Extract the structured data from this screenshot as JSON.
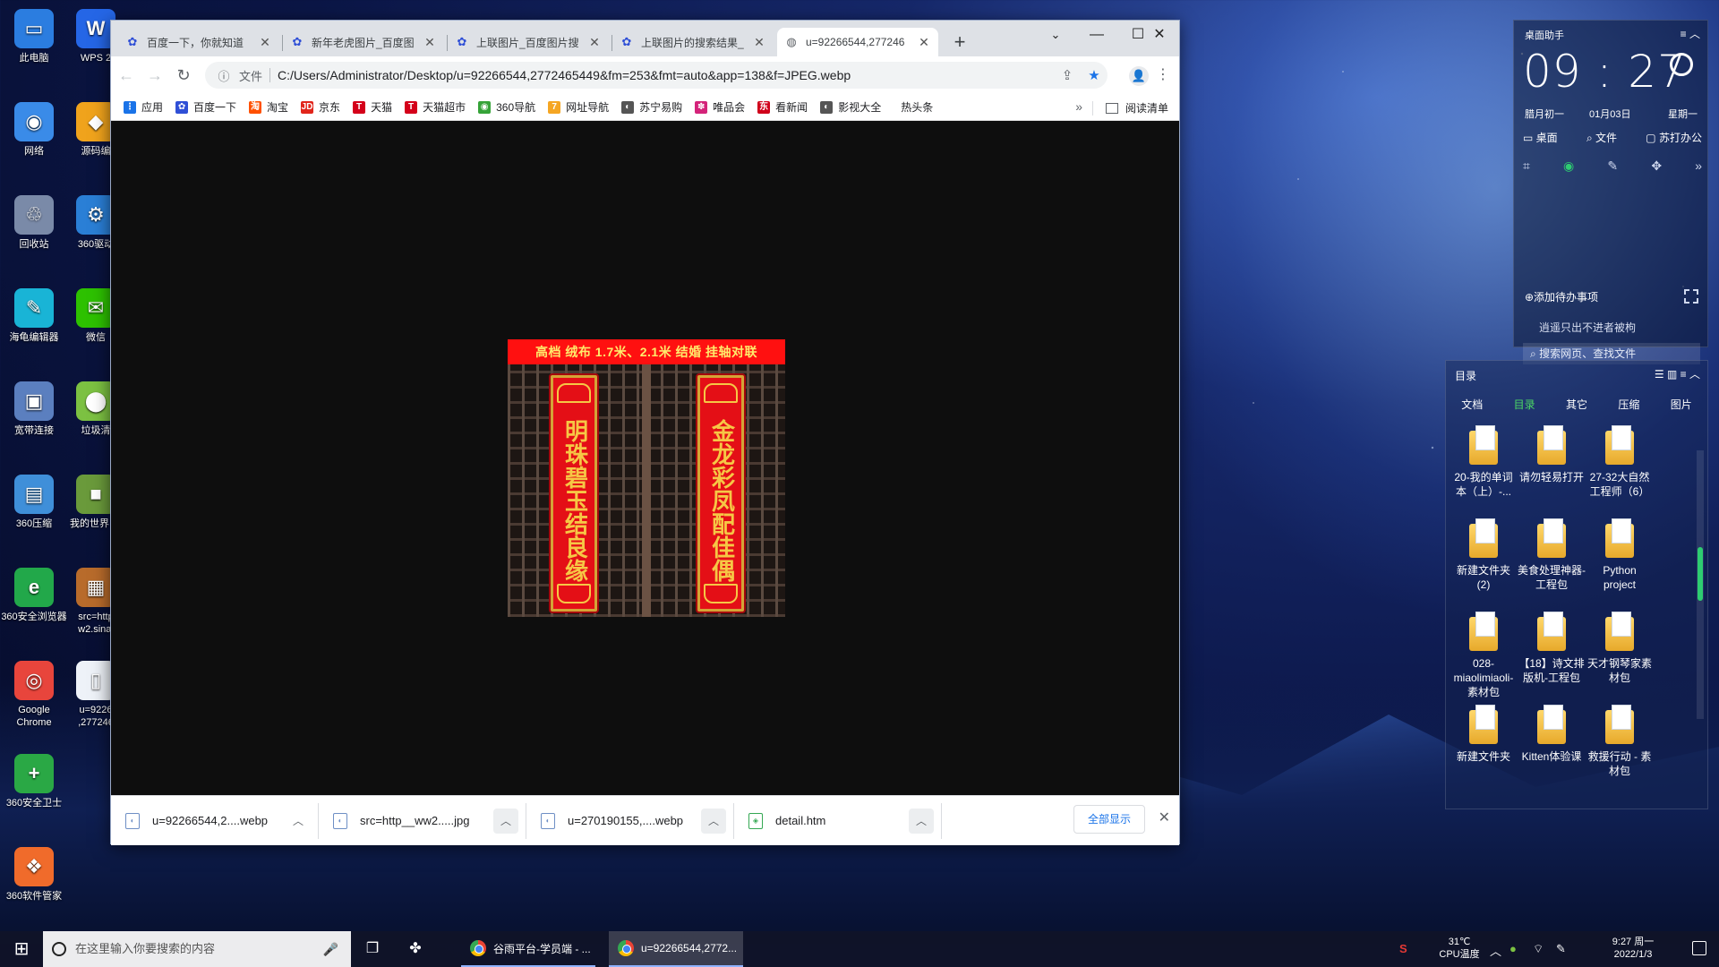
{
  "desktop_left": [
    {
      "label": "此电脑",
      "color": "#2b7de0",
      "glyph": "▭"
    },
    {
      "label": "网络",
      "color": "#3a8be8",
      "glyph": "◉"
    },
    {
      "label": "回收站",
      "color": "#7a8aa8",
      "glyph": "♲"
    },
    {
      "label": "海龟编辑器",
      "color": "#19b4d6",
      "glyph": "✎"
    },
    {
      "label": "宽带连接",
      "color": "#5b7fbf",
      "glyph": "▣"
    },
    {
      "label": "360压缩",
      "color": "#3f8fd9",
      "glyph": "▤"
    },
    {
      "label": "360安全浏览器",
      "color": "#22a84a",
      "glyph": "e"
    },
    {
      "label": "Google Chrome",
      "color": "#e8453c",
      "glyph": "◎"
    },
    {
      "label": "360安全卫士",
      "color": "#2aa845",
      "glyph": "+"
    },
    {
      "label": "360软件管家",
      "color": "#f06b2b",
      "glyph": "❖"
    }
  ],
  "desktop_right": [
    {
      "label": "WPS 2",
      "color": "#2566e6",
      "glyph": "W"
    },
    {
      "label": "源码编",
      "color": "#f0a31c",
      "glyph": "◆"
    },
    {
      "label": "360驱动",
      "color": "#2a7fd6",
      "glyph": "⚙"
    },
    {
      "label": "微信",
      "color": "#2dc100",
      "glyph": "✉"
    },
    {
      "label": "垃圾清",
      "color": "#7cc142",
      "glyph": "⬤"
    },
    {
      "label": "我的世界 器",
      "color": "#6a9a3b",
      "glyph": "■"
    },
    {
      "label": "src=http w2.sinai",
      "color": "#b86b2b",
      "glyph": "▦"
    },
    {
      "label": "u=9226 ,277246",
      "color": "#eef2f8",
      "glyph": "▯"
    }
  ],
  "browser": {
    "tabs": [
      {
        "title": "百度一下，你就知道"
      },
      {
        "title": "新年老虎图片_百度图"
      },
      {
        "title": "上联图片_百度图片搜"
      },
      {
        "title": "上联图片的搜索结果_"
      },
      {
        "title": "u=92266544,277246"
      }
    ],
    "new_tab": "+",
    "omnibox": {
      "label": "文件",
      "url": "C:/Users/Administrator/Desktop/u=92266544,2772465449&fm=253&fmt=auto&app=138&f=JPEG.webp"
    },
    "bookmarks": [
      {
        "label": "应用",
        "color": "#1a73e8",
        "glyph": "⋮"
      },
      {
        "label": "百度一下",
        "color": "#2f4fd6",
        "glyph": "✿"
      },
      {
        "label": "淘宝",
        "color": "#ff5000",
        "glyph": "淘"
      },
      {
        "label": "京东",
        "color": "#e1251b",
        "glyph": "JD"
      },
      {
        "label": "天猫",
        "color": "#d4001a",
        "glyph": "T"
      },
      {
        "label": "天猫超市",
        "color": "#d4001a",
        "glyph": "T"
      },
      {
        "label": "360导航",
        "color": "#35a338",
        "glyph": "◉"
      },
      {
        "label": "网址导航",
        "color": "#f5a623",
        "glyph": "7"
      },
      {
        "label": "苏宁易购",
        "color": "#555555",
        "glyph": "◐"
      },
      {
        "label": "唯品会",
        "color": "#d4237a",
        "glyph": "✽"
      },
      {
        "label": "看新闻",
        "color": "#d0021b",
        "glyph": "东"
      },
      {
        "label": "影视大全",
        "color": "#555555",
        "glyph": "◐"
      },
      {
        "label": "热头条",
        "color": "#ffffff",
        "glyph": ""
      }
    ],
    "more": "»",
    "reading_list": "阅读清单",
    "product": {
      "banner": "高档 绒布 1.7米、2.1米 结婚 挂轴对联",
      "left_scroll": "明珠碧玉结良缘",
      "right_scroll": "金龙彩凤配佳偶"
    },
    "downloads": [
      {
        "name": "u=92266544,2....webp"
      },
      {
        "name": "src=http__ww2.....jpg"
      },
      {
        "name": "u=270190155,....webp"
      },
      {
        "name": "detail.htm"
      }
    ],
    "show_all": "全部显示"
  },
  "clock_widget": {
    "title": "桌面助手",
    "time": "09 : 27",
    "lunar": "腊月初一",
    "date": "01月03日",
    "weekday": "星期一",
    "actions": [
      "桌面",
      "文件",
      "苏打办公"
    ],
    "add_todo": "⊕添加待办事项",
    "tip": "逍遥只出不进者被枸",
    "search": "搜索网页、查找文件"
  },
  "dir_widget": {
    "title": "目录",
    "tabs": [
      "文档",
      "目录",
      "其它",
      "压缩",
      "图片"
    ],
    "active_tab": "目录",
    "items": [
      "20-我的单词本（上）-...",
      "请勿轻易打开",
      "27-32大自然工程师（6）",
      "新建文件夹 (2)",
      "美食处理神器-工程包",
      "Python project",
      "028-miaolimiaoli-素材包",
      "【18】诗文排版机-工程包",
      "天才钢琴家素材包",
      "新建文件夹",
      "Kitten体验课",
      "救援行动 - 素材包"
    ]
  },
  "taskbar": {
    "search_placeholder": "在这里输入你要搜索的内容",
    "apps": [
      {
        "label": "谷雨平台-学员端 - ..."
      },
      {
        "label": "u=92266544,2772..."
      }
    ],
    "temp": "31℃",
    "temp_label": "CPU温度",
    "clock_time": "9:27 周一",
    "clock_date": "2022/1/3"
  }
}
